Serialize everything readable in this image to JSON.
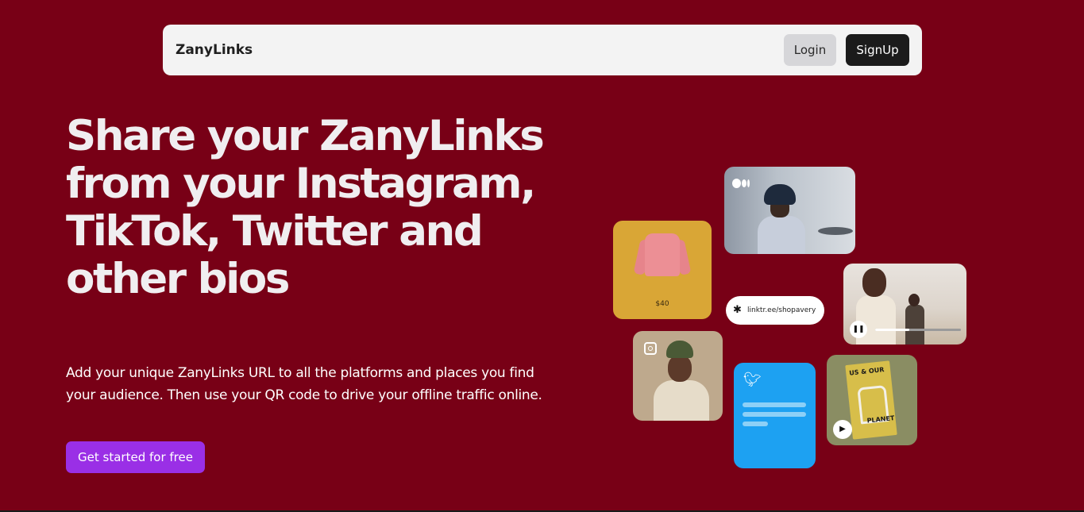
{
  "navbar": {
    "brand": "ZanyLinks",
    "login_label": "Login",
    "signup_label": "SignUp"
  },
  "hero": {
    "title": "Share your ZanyLinks from your Instagram, TikTok, Twitter and other bios",
    "description": "Add your unique ZanyLinks URL to all the platforms and places you find your audience. Then use your QR code to drive your offline traffic online.",
    "cta_label": "Get started for free"
  },
  "collage": {
    "product_price": "$40",
    "link_pill_text": "linktr.ee/shopavery",
    "video_progress": 0.4,
    "book_title_top": "US & OUR",
    "book_title_bottom": "PLANET",
    "icons": [
      "medium-icon",
      "instagram-icon",
      "twitter-icon",
      "pause-icon",
      "play-icon",
      "linktree-icon"
    ]
  },
  "colors": {
    "background": "#780016",
    "navbar_bg": "#f3f3f3",
    "login_bg": "#d6d6d9",
    "signup_bg": "#1b1b1b",
    "cta_bg": "#9a2fe6",
    "twitter_blue": "#1da1f2",
    "product_card": "#d9a636"
  }
}
